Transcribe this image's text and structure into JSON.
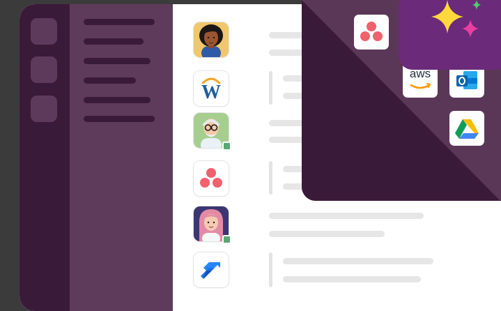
{
  "app": {
    "workspace_rail": {
      "item_count": 3
    },
    "sidebar": {
      "line_count": 6
    }
  },
  "channel_list": {
    "rows": [
      {
        "type": "avatar",
        "icon": "woman-avatar-icon"
      },
      {
        "type": "app",
        "icon": "workday-icon",
        "letter": "W"
      },
      {
        "type": "avatar",
        "icon": "elderly-man-avatar-icon",
        "online": true
      },
      {
        "type": "app",
        "icon": "asana-icon"
      },
      {
        "type": "avatar",
        "icon": "pink-haired-woman-avatar-icon",
        "online": true
      },
      {
        "type": "app",
        "icon": "jira-icon"
      }
    ]
  },
  "integrations_card": {
    "tiles": [
      {
        "icon": "asana-icon"
      },
      {
        "icon": "aws-icon",
        "label": "aws"
      },
      {
        "icon": "outlook-icon"
      },
      {
        "icon": "google-drive-icon"
      }
    ]
  },
  "badge": {
    "icon": "sparkles-icon"
  },
  "colors": {
    "rail": "#3a1a39",
    "sidebar": "#5e3b5b",
    "overlay": "#5b3757",
    "fold": "#3a1a39",
    "badge": "#6b2a7a",
    "presence": "#58a774",
    "placeholder": "#e6e6e6"
  }
}
